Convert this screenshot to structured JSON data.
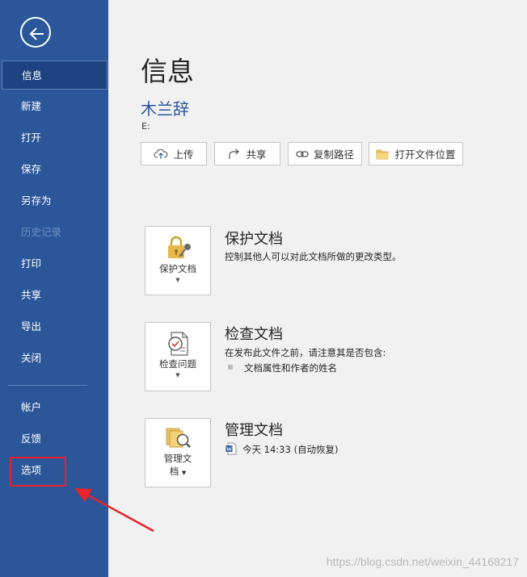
{
  "sidebar": {
    "items": [
      {
        "label": "信息"
      },
      {
        "label": "新建"
      },
      {
        "label": "打开"
      },
      {
        "label": "保存"
      },
      {
        "label": "另存为"
      },
      {
        "label": "历史记录"
      },
      {
        "label": "打印"
      },
      {
        "label": "共享"
      },
      {
        "label": "导出"
      },
      {
        "label": "关闭"
      },
      {
        "label": "帐户"
      },
      {
        "label": "反馈"
      },
      {
        "label": "选项"
      }
    ]
  },
  "main": {
    "title": "信息",
    "doc_name": "木兰辞",
    "doc_path": "E:",
    "actions": {
      "upload": "上传",
      "share": "共享",
      "copy_path": "复制路径",
      "open_location": "打开文件位置"
    },
    "protect": {
      "tile_label": "保护文档",
      "heading": "保护文档",
      "description": "控制其他人可以对此文档所做的更改类型。"
    },
    "inspect": {
      "tile_label": "检查问题",
      "heading": "检查文档",
      "description": "在发布此文件之前，请注意其是否包含:",
      "bullet": "文档属性和作者的姓名"
    },
    "manage": {
      "tile_label_line1": "管理文",
      "tile_label_line2": "档",
      "heading": "管理文档",
      "version": "今天 14:33 (自动恢复)"
    }
  },
  "watermark": "https://blog.csdn.net/weixin_44168217",
  "colors": {
    "sidebar_bg": "#2b579a",
    "accent": "#2b579a",
    "highlight": "#e8232a",
    "background": "#f1f1f1"
  }
}
